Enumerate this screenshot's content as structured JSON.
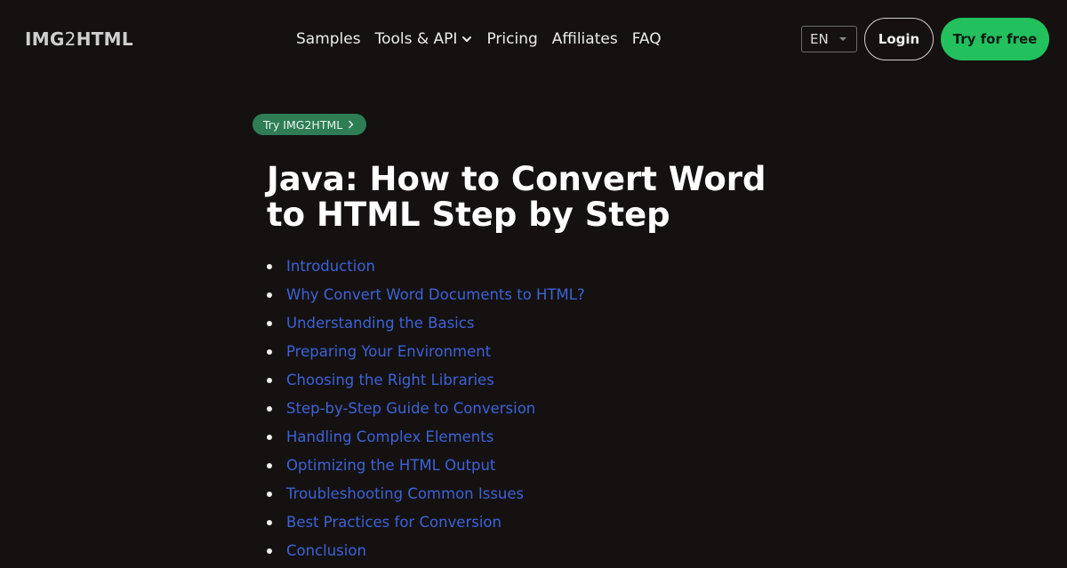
{
  "header": {
    "logo_left": "IMG",
    "logo_mid": "2",
    "logo_right": "HTML",
    "nav": [
      {
        "label": "Samples"
      },
      {
        "label": "Tools & API",
        "icon": "chevron-down-icon"
      },
      {
        "label": "Pricing"
      },
      {
        "label": "Affiliates"
      },
      {
        "label": "FAQ"
      }
    ],
    "language": "EN",
    "login_label": "Login",
    "try_label": "Try for free"
  },
  "badge": {
    "label": "Try IMG2HTML",
    "icon": "chevron-right-icon"
  },
  "article": {
    "title": "Java: How to Convert Word to HTML Step by Step",
    "toc": [
      "Introduction",
      "Why Convert Word Documents to HTML?",
      "Understanding the Basics",
      "Preparing Your Environment",
      "Choosing the Right Libraries",
      "Step-by-Step Guide to Conversion",
      "Handling Complex Elements",
      "Optimizing the HTML Output",
      "Troubleshooting Common Issues",
      "Best Practices for Conversion",
      "Conclusion"
    ]
  },
  "colors": {
    "background": "#151111",
    "accent_green": "#22c15e",
    "badge_green": "#2e7d55",
    "link_blue": "#3b63d6"
  }
}
